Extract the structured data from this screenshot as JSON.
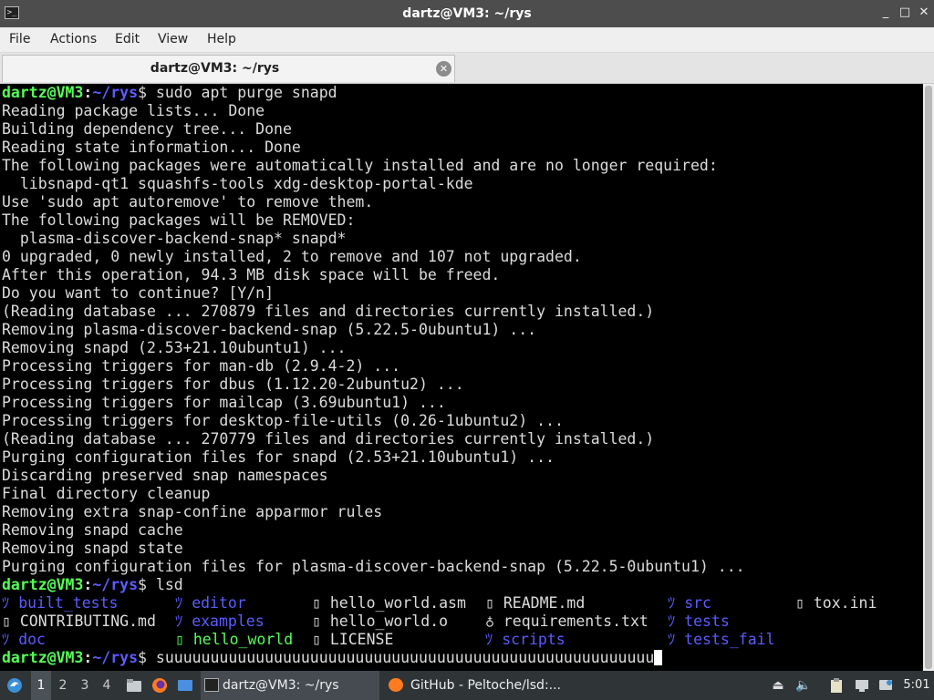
{
  "window": {
    "title": "dartz@VM3: ~/rys",
    "controls": {
      "minimize": "_",
      "maximize": "□",
      "close": "✕"
    }
  },
  "menu": [
    "File",
    "Actions",
    "Edit",
    "View",
    "Help"
  ],
  "tab": {
    "label": "dartz@VM3: ~/rys",
    "close": "✕"
  },
  "prompt": {
    "user": "dartz@VM3",
    "path": "~/rys",
    "symbol": "$"
  },
  "commands": {
    "first": "sudo apt purge snapd",
    "second": "lsd",
    "current": "suuuuuuuuuuuuuuuuuuuuuuuuuuuuuuuuuuuuuuuuuuuuuuuuuuuuuu"
  },
  "output": [
    "Reading package lists... Done",
    "Building dependency tree... Done",
    "Reading state information... Done",
    "The following packages were automatically installed and are no longer required:",
    "  libsnapd-qt1 squashfs-tools xdg-desktop-portal-kde",
    "Use 'sudo apt autoremove' to remove them.",
    "The following packages will be REMOVED:",
    "  plasma-discover-backend-snap* snapd*",
    "0 upgraded, 0 newly installed, 2 to remove and 107 not upgraded.",
    "After this operation, 94.3 MB disk space will be freed.",
    "Do you want to continue? [Y/n]",
    "(Reading database ... 270879 files and directories currently installed.)",
    "Removing plasma-discover-backend-snap (5.22.5-0ubuntu1) ...",
    "Removing snapd (2.53+21.10ubuntu1) ...",
    "Processing triggers for man-db (2.9.4-2) ...",
    "Processing triggers for dbus (1.12.20-2ubuntu2) ...",
    "Processing triggers for mailcap (3.69ubuntu1) ...",
    "Processing triggers for desktop-file-utils (0.26-1ubuntu2) ...",
    "(Reading database ... 270779 files and directories currently installed.)",
    "Purging configuration files for snapd (2.53+21.10ubuntu1) ...",
    "Discarding preserved snap namespaces",
    "Final directory cleanup",
    "Removing extra snap-confine apparmor rules",
    "Removing snapd cache",
    "Removing snapd state",
    "Purging configuration files for plasma-discover-backend-snap (5.22.5-0ubuntu1) ..."
  ],
  "ls": [
    [
      {
        "icon": "ﾂ",
        "name": "built_tests",
        "kind": "dir"
      },
      {
        "icon": "ﾂ",
        "name": "editor",
        "kind": "dir"
      },
      {
        "icon": "▯",
        "name": "hello_world.asm",
        "kind": "file"
      },
      {
        "icon": "▯",
        "name": "README.md",
        "kind": "file"
      },
      {
        "icon": "ﾂ",
        "name": "src",
        "kind": "dir"
      },
      {
        "icon": "▯",
        "name": "tox.ini",
        "kind": "file"
      }
    ],
    [
      {
        "icon": "▯",
        "name": "CONTRIBUTING.md",
        "kind": "file"
      },
      {
        "icon": "ﾂ",
        "name": "examples",
        "kind": "dir"
      },
      {
        "icon": "▯",
        "name": "hello_world.o",
        "kind": "file"
      },
      {
        "icon": "♁",
        "name": "requirements.txt",
        "kind": "file"
      },
      {
        "icon": "ﾂ",
        "name": "tests",
        "kind": "dir"
      }
    ],
    [
      {
        "icon": "ﾂ",
        "name": "doc",
        "kind": "dir"
      },
      {
        "icon": "▯",
        "name": "hello_world",
        "kind": "exe"
      },
      {
        "icon": "▯",
        "name": "LICENSE",
        "kind": "file"
      },
      {
        "icon": "ﾂ",
        "name": "scripts",
        "kind": "dir"
      },
      {
        "icon": "ﾂ",
        "name": "tests_fail",
        "kind": "dir"
      }
    ]
  ],
  "taskbar": {
    "workspaces": [
      "1",
      "2",
      "3",
      "4"
    ],
    "active_workspace": "1",
    "tasks": [
      {
        "label": "dartz@VM3: ~/rys",
        "icon": "terminal-icon"
      },
      {
        "label": "GitHub - Peltoche/lsd:...",
        "icon": "firefox-icon"
      }
    ],
    "clock": "5:01"
  },
  "colors": {
    "prompt_user": "#55ff55",
    "prompt_path": "#5c5cff",
    "terminal_bg": "#000000",
    "terminal_fg": "#dcdcdc",
    "titlebar": "#4d4d4d",
    "taskbar": "#2f3437"
  }
}
